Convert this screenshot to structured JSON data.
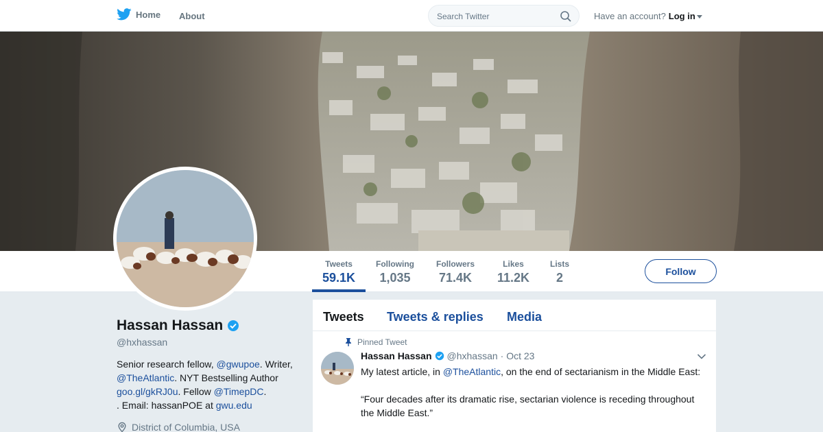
{
  "nav": {
    "home_label": "Home",
    "about_label": "About",
    "search_placeholder": "Search Twitter",
    "account_prompt": "Have an account?",
    "login_label": "Log in"
  },
  "colors": {
    "brand_blue": "#1da1f2",
    "link_blue": "#1b4f9c",
    "verified": "#1da1f2"
  },
  "profile": {
    "name": "Hassan Hassan",
    "handle": "@hxhassan",
    "bio": {
      "t1": "Senior research fellow, ",
      "l1": "@gwupoe",
      "t2": ". Writer, ",
      "l2": "@TheAtlantic",
      "t3": ". NYT Bestselling Author ",
      "l3": "goo.gl/gkRJ0u",
      "t4": ". Fellow ",
      "l4": "@TimepDC",
      "t5": ". Email: hassanPOE at ",
      "l5": "gwu.edu"
    },
    "location": "District of Columbia, USA"
  },
  "stats": [
    {
      "label": "Tweets",
      "value": "59.1K"
    },
    {
      "label": "Following",
      "value": "1,035"
    },
    {
      "label": "Followers",
      "value": "71.4K"
    },
    {
      "label": "Likes",
      "value": "11.2K"
    },
    {
      "label": "Lists",
      "value": "2"
    }
  ],
  "follow_label": "Follow",
  "timeline": {
    "tabs": [
      "Tweets",
      "Tweets & replies",
      "Media"
    ],
    "pinned_label": "Pinned Tweet",
    "tweet": {
      "name": "Hassan Hassan",
      "handle": "@hxhassan",
      "date": "· Oct 23",
      "line1_pre": "My latest article, in ",
      "line1_link": "@TheAtlantic",
      "line1_post": ", on the end of sectarianism in the Middle East:",
      "quote": "“Four decades after its dramatic rise, sectarian violence is receding throughout the Middle East.”"
    }
  }
}
